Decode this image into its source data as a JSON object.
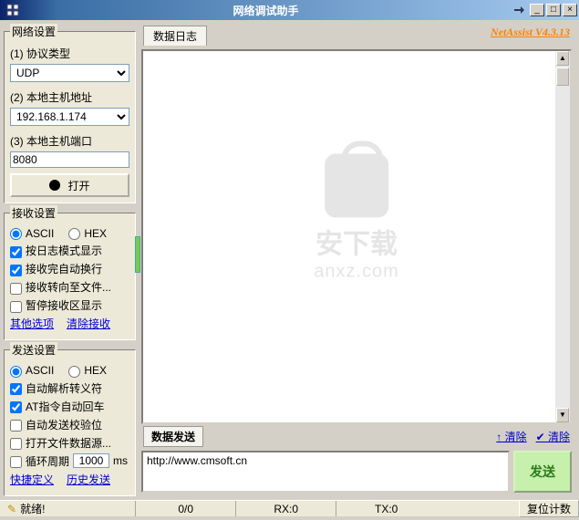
{
  "window": {
    "title": "网络调试助手"
  },
  "brand": "NetAssist V4.3.13",
  "network": {
    "legend": "网络设置",
    "protocol_label": "(1) 协议类型",
    "protocol_value": "UDP",
    "host_label": "(2) 本地主机地址",
    "host_value": "192.168.1.174",
    "port_label": "(3) 本地主机端口",
    "port_value": "8080",
    "open_label": "打开"
  },
  "recv": {
    "legend": "接收设置",
    "ascii": "ASCII",
    "hex": "HEX",
    "opt1": "按日志模式显示",
    "opt2": "接收完自动换行",
    "opt3": "接收转向至文件...",
    "opt4": "暂停接收区显示",
    "link1": "其他选项",
    "link2": "清除接收"
  },
  "send": {
    "legend": "发送设置",
    "ascii": "ASCII",
    "hex": "HEX",
    "opt1": "自动解析转义符",
    "opt2": "AT指令自动回车",
    "opt3": "自动发送校验位",
    "opt4": "打开文件数据源...",
    "cycle_label": "循环周期",
    "cycle_value": "1000",
    "cycle_unit": "ms",
    "link1": "快捷定义",
    "link2": "历史发送"
  },
  "log": {
    "tab": "数据日志",
    "watermark_cn": "安下载",
    "watermark_en": "anxz.com"
  },
  "sendarea": {
    "tab": "数据发送",
    "clear_up": "↑ 清除",
    "clear_down": "✔ 清除",
    "content": "http://www.cmsoft.cn",
    "button": "发送"
  },
  "status": {
    "ready": "就绪!",
    "counter1": "0/0",
    "rx": "RX:0",
    "tx": "TX:0",
    "reset": "复位计数"
  }
}
